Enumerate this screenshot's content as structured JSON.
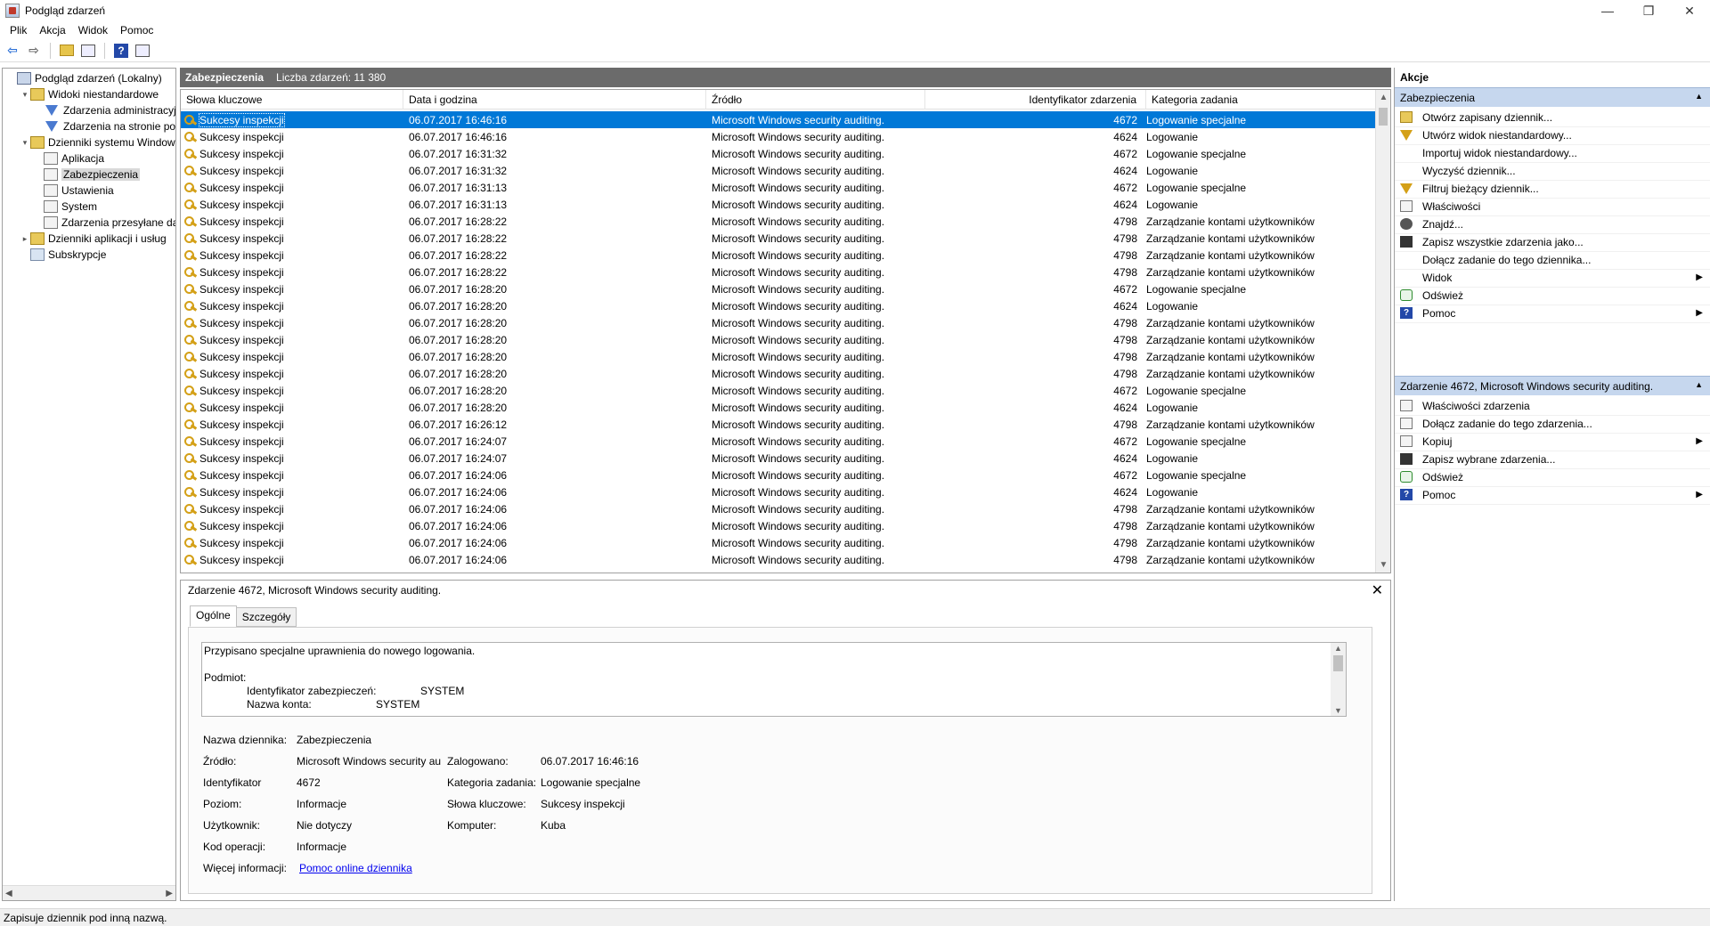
{
  "window": {
    "title": "Podgląd zdarzeń",
    "minimize": "—",
    "maximize": "❐",
    "close": "✕"
  },
  "menu": [
    "Plik",
    "Akcja",
    "Widok",
    "Pomoc"
  ],
  "tree": {
    "items": [
      {
        "label": "Podgląd zdarzeń (Lokalny)",
        "level": 0,
        "expander": "",
        "icon": "root"
      },
      {
        "label": "Widoki niestandardowe",
        "level": 1,
        "expander": "▾",
        "icon": "folder"
      },
      {
        "label": "Zdarzenia administracyjne",
        "level": 2,
        "expander": "",
        "icon": "filter"
      },
      {
        "label": "Zdarzenia na stronie pod",
        "level": 2,
        "expander": "",
        "icon": "filter"
      },
      {
        "label": "Dzienniki systemu Windows",
        "level": 1,
        "expander": "▾",
        "icon": "folder"
      },
      {
        "label": "Aplikacja",
        "level": 2,
        "expander": "",
        "icon": "log"
      },
      {
        "label": "Zabezpieczenia",
        "level": 2,
        "expander": "",
        "icon": "log",
        "selected": true
      },
      {
        "label": "Ustawienia",
        "level": 2,
        "expander": "",
        "icon": "log"
      },
      {
        "label": "System",
        "level": 2,
        "expander": "",
        "icon": "log"
      },
      {
        "label": "Zdarzenia przesyłane dale",
        "level": 2,
        "expander": "",
        "icon": "log"
      },
      {
        "label": "Dzienniki aplikacji i usług",
        "level": 1,
        "expander": "▸",
        "icon": "folder"
      },
      {
        "label": "Subskrypcje",
        "level": 1,
        "expander": "",
        "icon": "sub"
      }
    ]
  },
  "center": {
    "log_name": "Zabezpieczenia",
    "event_count": "Liczba zdarzeń: 11 380"
  },
  "columns": [
    "Słowa kluczowe",
    "Data i godzina",
    "Źródło",
    "Identyfikator zdarzenia",
    "Kategoria zadania"
  ],
  "events": [
    {
      "kw": "Sukcesy inspekcji",
      "date": "06.07.2017 16:46:16",
      "src": "Microsoft Windows security auditing.",
      "id": "4672",
      "cat": "Logowanie specjalne"
    },
    {
      "kw": "Sukcesy inspekcji",
      "date": "06.07.2017 16:46:16",
      "src": "Microsoft Windows security auditing.",
      "id": "4624",
      "cat": "Logowanie"
    },
    {
      "kw": "Sukcesy inspekcji",
      "date": "06.07.2017 16:31:32",
      "src": "Microsoft Windows security auditing.",
      "id": "4672",
      "cat": "Logowanie specjalne"
    },
    {
      "kw": "Sukcesy inspekcji",
      "date": "06.07.2017 16:31:32",
      "src": "Microsoft Windows security auditing.",
      "id": "4624",
      "cat": "Logowanie"
    },
    {
      "kw": "Sukcesy inspekcji",
      "date": "06.07.2017 16:31:13",
      "src": "Microsoft Windows security auditing.",
      "id": "4672",
      "cat": "Logowanie specjalne"
    },
    {
      "kw": "Sukcesy inspekcji",
      "date": "06.07.2017 16:31:13",
      "src": "Microsoft Windows security auditing.",
      "id": "4624",
      "cat": "Logowanie"
    },
    {
      "kw": "Sukcesy inspekcji",
      "date": "06.07.2017 16:28:22",
      "src": "Microsoft Windows security auditing.",
      "id": "4798",
      "cat": "Zarządzanie kontami użytkowników"
    },
    {
      "kw": "Sukcesy inspekcji",
      "date": "06.07.2017 16:28:22",
      "src": "Microsoft Windows security auditing.",
      "id": "4798",
      "cat": "Zarządzanie kontami użytkowników"
    },
    {
      "kw": "Sukcesy inspekcji",
      "date": "06.07.2017 16:28:22",
      "src": "Microsoft Windows security auditing.",
      "id": "4798",
      "cat": "Zarządzanie kontami użytkowników"
    },
    {
      "kw": "Sukcesy inspekcji",
      "date": "06.07.2017 16:28:22",
      "src": "Microsoft Windows security auditing.",
      "id": "4798",
      "cat": "Zarządzanie kontami użytkowników"
    },
    {
      "kw": "Sukcesy inspekcji",
      "date": "06.07.2017 16:28:20",
      "src": "Microsoft Windows security auditing.",
      "id": "4672",
      "cat": "Logowanie specjalne"
    },
    {
      "kw": "Sukcesy inspekcji",
      "date": "06.07.2017 16:28:20",
      "src": "Microsoft Windows security auditing.",
      "id": "4624",
      "cat": "Logowanie"
    },
    {
      "kw": "Sukcesy inspekcji",
      "date": "06.07.2017 16:28:20",
      "src": "Microsoft Windows security auditing.",
      "id": "4798",
      "cat": "Zarządzanie kontami użytkowników"
    },
    {
      "kw": "Sukcesy inspekcji",
      "date": "06.07.2017 16:28:20",
      "src": "Microsoft Windows security auditing.",
      "id": "4798",
      "cat": "Zarządzanie kontami użytkowników"
    },
    {
      "kw": "Sukcesy inspekcji",
      "date": "06.07.2017 16:28:20",
      "src": "Microsoft Windows security auditing.",
      "id": "4798",
      "cat": "Zarządzanie kontami użytkowników"
    },
    {
      "kw": "Sukcesy inspekcji",
      "date": "06.07.2017 16:28:20",
      "src": "Microsoft Windows security auditing.",
      "id": "4798",
      "cat": "Zarządzanie kontami użytkowników"
    },
    {
      "kw": "Sukcesy inspekcji",
      "date": "06.07.2017 16:28:20",
      "src": "Microsoft Windows security auditing.",
      "id": "4672",
      "cat": "Logowanie specjalne"
    },
    {
      "kw": "Sukcesy inspekcji",
      "date": "06.07.2017 16:28:20",
      "src": "Microsoft Windows security auditing.",
      "id": "4624",
      "cat": "Logowanie"
    },
    {
      "kw": "Sukcesy inspekcji",
      "date": "06.07.2017 16:26:12",
      "src": "Microsoft Windows security auditing.",
      "id": "4798",
      "cat": "Zarządzanie kontami użytkowników"
    },
    {
      "kw": "Sukcesy inspekcji",
      "date": "06.07.2017 16:24:07",
      "src": "Microsoft Windows security auditing.",
      "id": "4672",
      "cat": "Logowanie specjalne"
    },
    {
      "kw": "Sukcesy inspekcji",
      "date": "06.07.2017 16:24:07",
      "src": "Microsoft Windows security auditing.",
      "id": "4624",
      "cat": "Logowanie"
    },
    {
      "kw": "Sukcesy inspekcji",
      "date": "06.07.2017 16:24:06",
      "src": "Microsoft Windows security auditing.",
      "id": "4672",
      "cat": "Logowanie specjalne"
    },
    {
      "kw": "Sukcesy inspekcji",
      "date": "06.07.2017 16:24:06",
      "src": "Microsoft Windows security auditing.",
      "id": "4624",
      "cat": "Logowanie"
    },
    {
      "kw": "Sukcesy inspekcji",
      "date": "06.07.2017 16:24:06",
      "src": "Microsoft Windows security auditing.",
      "id": "4798",
      "cat": "Zarządzanie kontami użytkowników"
    },
    {
      "kw": "Sukcesy inspekcji",
      "date": "06.07.2017 16:24:06",
      "src": "Microsoft Windows security auditing.",
      "id": "4798",
      "cat": "Zarządzanie kontami użytkowników"
    },
    {
      "kw": "Sukcesy inspekcji",
      "date": "06.07.2017 16:24:06",
      "src": "Microsoft Windows security auditing.",
      "id": "4798",
      "cat": "Zarządzanie kontami użytkowników"
    },
    {
      "kw": "Sukcesy inspekcji",
      "date": "06.07.2017 16:24:06",
      "src": "Microsoft Windows security auditing.",
      "id": "4798",
      "cat": "Zarządzanie kontami użytkowników"
    }
  ],
  "detail": {
    "title": "Zdarzenie 4672, Microsoft Windows security auditing.",
    "tabs": [
      "Ogólne",
      "Szczegóły"
    ],
    "description": {
      "line1": "Przypisano specjalne uprawnienia do nowego logowania.",
      "line2": "Podmiot:",
      "line3_label": "Identyfikator zabezpieczeń:",
      "line3_value": "SYSTEM",
      "line4_label": "Nazwa konta:",
      "line4_value": "SYSTEM"
    },
    "props": {
      "log_name_label": "Nazwa dziennika:",
      "log_name_value": "Zabezpieczenia",
      "source_label": "Źródło:",
      "source_value": "Microsoft Windows security au",
      "logged_label": "Zalogowano:",
      "logged_value": "06.07.2017 16:46:16",
      "id_label": "Identyfikator",
      "id_value": "4672",
      "task_label": "Kategoria zadania:",
      "task_value": "Logowanie specjalne",
      "level_label": "Poziom:",
      "level_value": "Informacje",
      "keywords_label": "Słowa kluczowe:",
      "keywords_value": "Sukcesy inspekcji",
      "user_label": "Użytkownik:",
      "user_value": "Nie dotyczy",
      "computer_label": "Komputer:",
      "computer_value": "Kuba",
      "opcode_label": "Kod operacji:",
      "opcode_value": "Informacje",
      "more_label": "Więcej informacji:",
      "more_link": "Pomoc online dziennika"
    }
  },
  "actions": {
    "title": "Akcje",
    "section1": "Zabezpieczenia",
    "items1": [
      {
        "label": "Otwórz zapisany dziennik...",
        "icon": "open",
        "sub": false
      },
      {
        "label": "Utwórz widok niestandardowy...",
        "icon": "filter",
        "sub": false
      },
      {
        "label": "Importuj widok niestandardowy...",
        "icon": "none",
        "sub": false
      },
      {
        "label": "Wyczyść dziennik...",
        "icon": "none",
        "sub": false
      },
      {
        "label": "Filtruj bieżący dziennik...",
        "icon": "filter",
        "sub": false
      },
      {
        "label": "Właściwości",
        "icon": "doc",
        "sub": false
      },
      {
        "label": "Znajdź...",
        "icon": "find",
        "sub": false
      },
      {
        "label": "Zapisz wszystkie zdarzenia jako...",
        "icon": "save",
        "sub": false
      },
      {
        "label": "Dołącz zadanie do tego dziennika...",
        "icon": "none",
        "sub": false
      },
      {
        "label": "Widok",
        "icon": "none",
        "sub": true
      },
      {
        "label": "Odśwież",
        "icon": "refresh",
        "sub": false
      },
      {
        "label": "Pomoc",
        "icon": "help",
        "sub": true
      }
    ],
    "section2": "Zdarzenie 4672, Microsoft Windows security auditing.",
    "items2": [
      {
        "label": "Właściwości zdarzenia",
        "icon": "doc",
        "sub": false
      },
      {
        "label": "Dołącz zadanie do tego zdarzenia...",
        "icon": "doc",
        "sub": false
      },
      {
        "label": "Kopiuj",
        "icon": "doc",
        "sub": true
      },
      {
        "label": "Zapisz wybrane zdarzenia...",
        "icon": "save",
        "sub": false
      },
      {
        "label": "Odśwież",
        "icon": "refresh",
        "sub": false
      },
      {
        "label": "Pomoc",
        "icon": "help",
        "sub": true
      }
    ]
  },
  "status": "Zapisuje dziennik pod inną nazwą.",
  "colors": {
    "selection": "#0078d7",
    "header_strip": "#6b6b6b",
    "action_section": "#c6d7ee"
  }
}
